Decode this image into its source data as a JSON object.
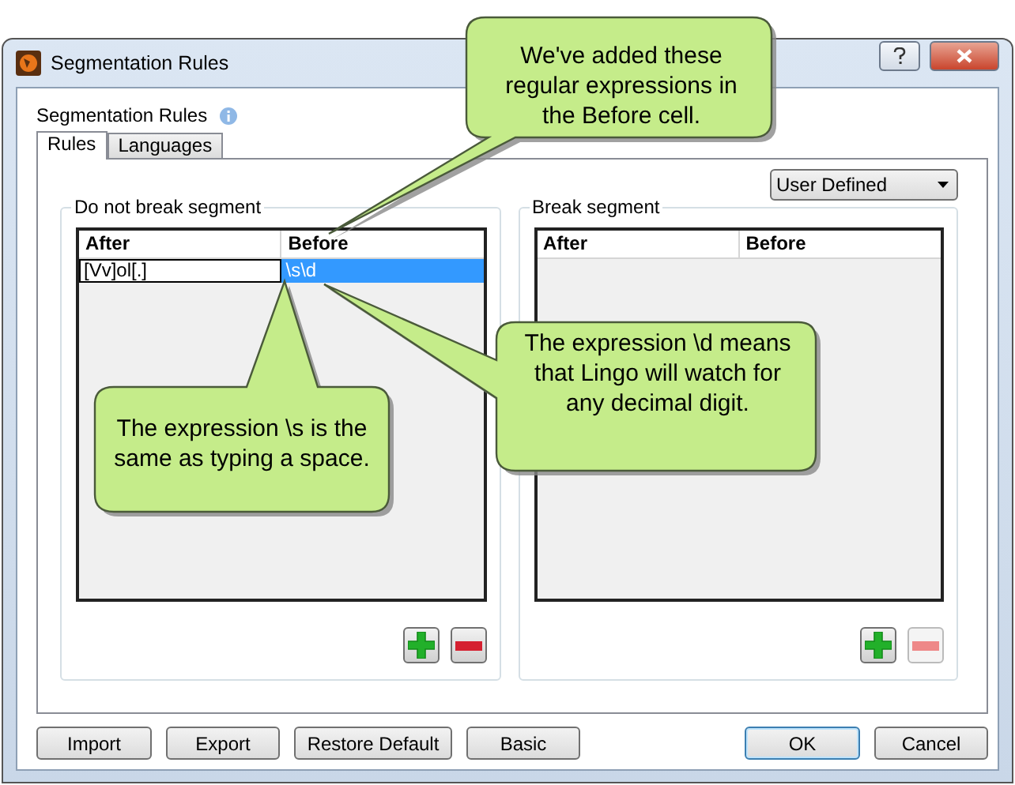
{
  "window": {
    "title": "Segmentation Rules"
  },
  "header": {
    "label": "Segmentation Rules"
  },
  "tabs": [
    {
      "label": "Rules",
      "selected": true
    },
    {
      "label": "Languages",
      "selected": false
    }
  ],
  "dropdown": {
    "value": "User Defined"
  },
  "groups": [
    {
      "title": "Do not break segment",
      "columns": [
        "After",
        "Before"
      ],
      "rows": [
        {
          "cells": [
            {
              "text": "[Vv]ol[.]",
              "editing": true,
              "selected": false
            },
            {
              "text": "\\s\\d",
              "editing": false,
              "selected": true
            }
          ]
        }
      ],
      "remove_disabled": false
    },
    {
      "title": "Break segment",
      "columns": [
        "After",
        "Before"
      ],
      "remove_disabled": true
    }
  ],
  "footer_buttons": [
    {
      "label": "Import",
      "default": false
    },
    {
      "label": "Export",
      "default": false
    },
    {
      "label": "Restore Default",
      "default": false
    },
    {
      "label": "Basic",
      "default": false
    },
    {
      "label": "OK",
      "default": true
    },
    {
      "label": "Cancel",
      "default": false
    }
  ],
  "callouts": [
    {
      "text": "We've added these regular expressions in the Before cell."
    },
    {
      "text": "The expression \\d means that Lingo will watch for any decimal digit."
    },
    {
      "text": "The expression \\s is the same as typing a space."
    }
  ]
}
